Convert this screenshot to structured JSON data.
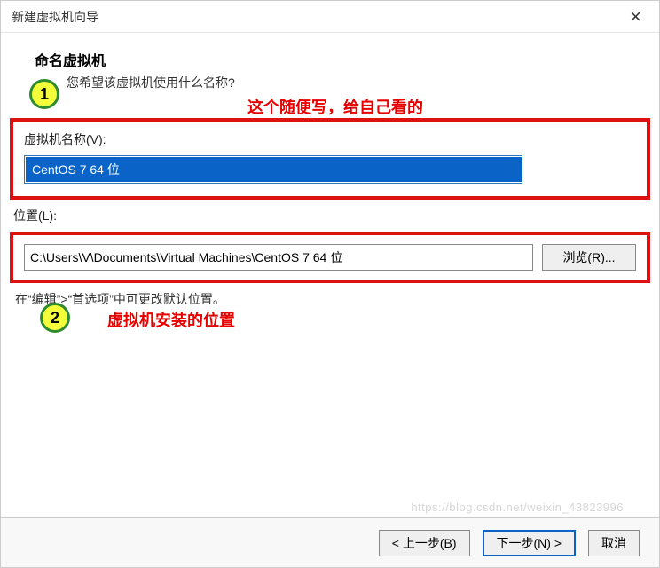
{
  "window": {
    "title": "新建虚拟机向导"
  },
  "header": {
    "heading": "命名虚拟机",
    "subheading": "您希望该虚拟机使用什么名称?"
  },
  "annotations": {
    "note1": "这个随便写，给自己看的",
    "bullet1": "1",
    "note2": "虚拟机安装的位置",
    "bullet2": "2"
  },
  "fields": {
    "name_label": "虚拟机名称(V):",
    "name_value": "CentOS 7 64 位",
    "location_label": "位置(L):",
    "location_value": "C:\\Users\\V\\Documents\\Virtual Machines\\CentOS 7 64 位",
    "browse_label": "浏览(R)...",
    "hint": "在“编辑”>“首选项”中可更改默认位置。"
  },
  "footer": {
    "back": "< 上一步(B)",
    "next": "下一步(N) >",
    "cancel": "取消"
  },
  "watermark": "https://blog.csdn.net/weixin_43823996"
}
